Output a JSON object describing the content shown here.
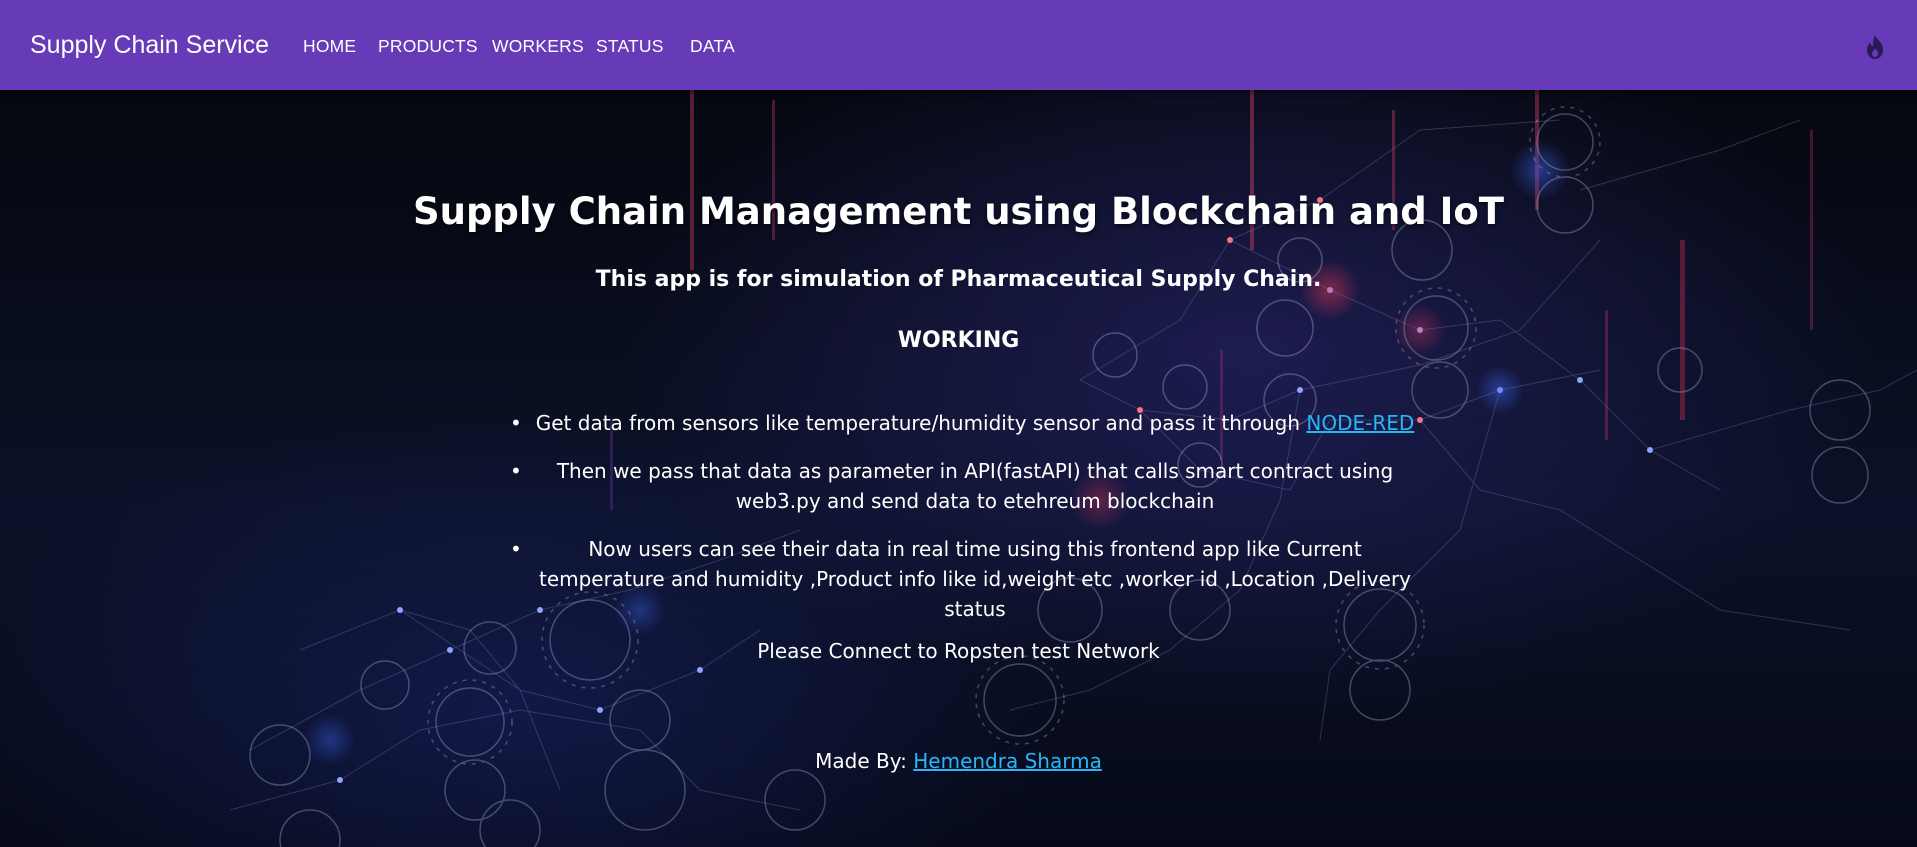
{
  "navbar": {
    "brand": "Supply Chain Service",
    "items": [
      {
        "label": "HOME"
      },
      {
        "label": "PRODUCTS"
      },
      {
        "label": "WORKERS"
      },
      {
        "label": "STATUS"
      },
      {
        "label": "DATA"
      }
    ],
    "icon": "fire-icon",
    "color": "#673ab7"
  },
  "main": {
    "title": "Supply Chain Management using Blockchain and IoT",
    "subtitle": "This app is for simulation of Pharmaceutical Supply Chain.",
    "section_heading": "WORKING",
    "list": [
      {
        "text_before": "Get data from sensors like temperature/humidity sensor and pass it through ",
        "link": "NODE-RED"
      },
      {
        "text": "Then we pass that data as parameter in API(fastAPI) that calls smart contract using web3.py and send data to etehreum blockchain"
      },
      {
        "text": "Now users can see their data in real time using this frontend app like Current temperature and humidity ,Product info like id,weight etc ,worker id ,Location ,Delivery status"
      }
    ],
    "connect_message": "Please Connect to Ropsten test Network",
    "made_by_label": "Made By: ",
    "author": "Hemendra Sharma",
    "link_color": "#29b6f6"
  }
}
